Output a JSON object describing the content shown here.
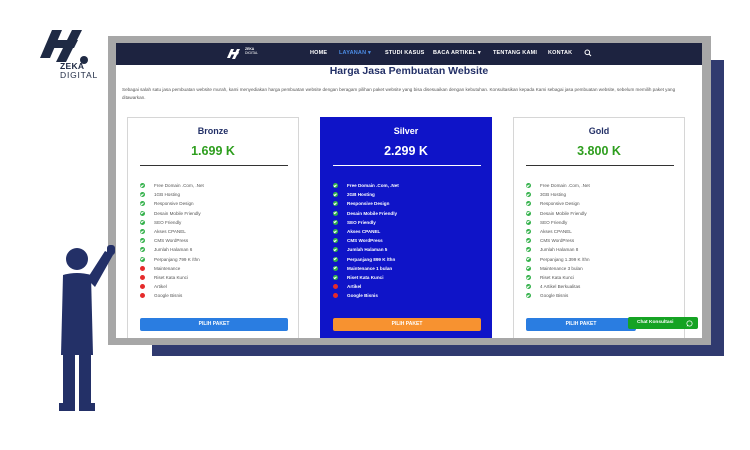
{
  "brand": {
    "logo_line1": "ZEKA",
    "logo_line2": "DIGITAL"
  },
  "site": {
    "logo_text_1": "ZEKA",
    "logo_text_2": "DIGITAL",
    "nav": [
      {
        "label": "HOME"
      },
      {
        "label": "LAYANAN ▾"
      },
      {
        "label": "STUDI KASUS"
      },
      {
        "label": "BACA ARTIKEL ▾"
      },
      {
        "label": "TENTANG KAMI"
      },
      {
        "label": "KONTAK"
      }
    ],
    "search_icon": "search-icon",
    "page_title": "Harga Jasa Pembuatan Website",
    "intro": "Sebagai salah satu jasa pembuatan website murah, kami menyediakan harga pembuatan website dengan beragam pilihan paket website yang bisa disesuaikan dengan kebutuhan. Konsultasikan kepada Kami sebagai jasa pembuatan website, sebelum memilih paket yang ditawarkan.",
    "colors": {
      "nav_bg": "#1d2340",
      "nav_active": "#4c8de6",
      "silver_bg": "#0f14c8",
      "price_green": "#2e9e1e",
      "button_blue": "#2a7de1",
      "button_orange": "#f79230",
      "check_green": "#33b14a",
      "cross_red": "#e52b2b"
    }
  },
  "plans": [
    {
      "name": "Bronze",
      "price": "1.699 K",
      "button": "PILIH PAKET",
      "features": [
        {
          "text": "Free Domain .Com, .Net",
          "included": true
        },
        {
          "text": "1GB Hosting",
          "included": true
        },
        {
          "text": "Responsive Design",
          "included": true
        },
        {
          "text": "Desain Mobile Friendly",
          "included": true
        },
        {
          "text": "SEO Friendly",
          "included": true
        },
        {
          "text": "Akses CPANEL",
          "included": true
        },
        {
          "text": "CMS WordPress",
          "included": true
        },
        {
          "text": "Jumlah Halaman 6",
          "included": true
        },
        {
          "text": "Perpanjang 799 K /thn",
          "included": true
        },
        {
          "text": "Maintenance",
          "included": false
        },
        {
          "text": "Riset Kata Kunci",
          "included": false
        },
        {
          "text": "Artikel",
          "included": false
        },
        {
          "text": "Google Bisnis",
          "included": false
        }
      ]
    },
    {
      "name": "Silver",
      "price": "2.299 K",
      "button": "PILIH PAKET",
      "features": [
        {
          "text": "Free Domain .Com, .Net",
          "included": true
        },
        {
          "text": "2GB Hosting",
          "included": true
        },
        {
          "text": "Responsive Design",
          "included": true
        },
        {
          "text": "Desain Mobile Friendly",
          "included": true
        },
        {
          "text": "SEO Friendly",
          "included": true
        },
        {
          "text": "Akses CPANEL",
          "included": true
        },
        {
          "text": "CMS WordPress",
          "included": true
        },
        {
          "text": "Jumlah Halaman 5",
          "included": true
        },
        {
          "text": "Perpanjang 899 K /thn",
          "included": true
        },
        {
          "text": "Maintenance 1 bulan",
          "included": true
        },
        {
          "text": "Riset Kata Kunci",
          "included": true
        },
        {
          "text": "Artikel",
          "included": false
        },
        {
          "text": "Google Bisnis",
          "included": false
        }
      ]
    },
    {
      "name": "Gold",
      "price": "3.800 K",
      "button": "PILIH PAKET",
      "features": [
        {
          "text": "Free Domain .Com, .Net",
          "included": true
        },
        {
          "text": "3GB Hosting",
          "included": true
        },
        {
          "text": "Responsive Design",
          "included": true
        },
        {
          "text": "Desain Mobile Friendly",
          "included": true
        },
        {
          "text": "SEO Friendly",
          "included": true
        },
        {
          "text": "Akses CPANEL",
          "included": true
        },
        {
          "text": "CMS WordPress",
          "included": true
        },
        {
          "text": "Jumlah Halaman 8",
          "included": true
        },
        {
          "text": "Perpanjang 1.399 K /thn",
          "included": true
        },
        {
          "text": "Maintenance 3 bulan",
          "included": true
        },
        {
          "text": "Riset Kata Kunci",
          "included": true
        },
        {
          "text": "4 Artikel Berkualitas",
          "included": true
        },
        {
          "text": "Google Bisnis",
          "included": true
        }
      ]
    }
  ],
  "chat": {
    "label": "Chat Konsultasi",
    "icon": "whatsapp-icon"
  }
}
